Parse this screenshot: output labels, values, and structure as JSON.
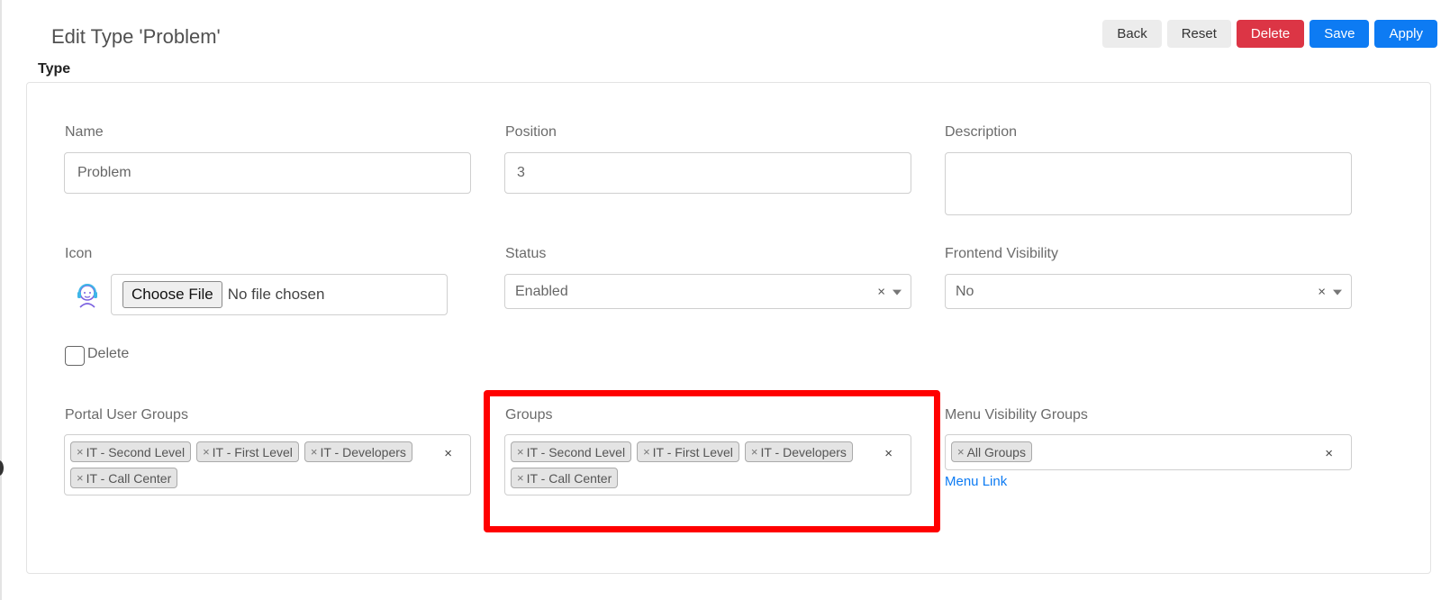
{
  "page": {
    "title": "Edit Type 'Problem'",
    "section_label": "Type"
  },
  "toolbar": {
    "back": "Back",
    "reset": "Reset",
    "delete": "Delete",
    "save": "Save",
    "apply": "Apply"
  },
  "colors": {
    "danger": "#dc3545",
    "primary": "#0d7bf3",
    "highlight": "#ff0000"
  },
  "form": {
    "name": {
      "label": "Name",
      "value": "Problem"
    },
    "position": {
      "label": "Position",
      "value": "3"
    },
    "description": {
      "label": "Description",
      "value": ""
    },
    "icon": {
      "label": "Icon",
      "preview_icon": "user-headset-icon",
      "file_button": "Choose File",
      "file_status": "No file chosen"
    },
    "status": {
      "label": "Status",
      "value": "Enabled"
    },
    "frontend_visibility": {
      "label": "Frontend Visibility",
      "value": "No"
    },
    "delete_checkbox": {
      "label": "Delete",
      "checked": false
    },
    "portal_user_groups": {
      "label": "Portal User Groups",
      "tags": [
        "IT - Second Level",
        "IT - First Level",
        "IT - Developers",
        "IT - Call Center"
      ]
    },
    "groups": {
      "label": "Groups",
      "tags": [
        "IT - Second Level",
        "IT - First Level",
        "IT - Developers",
        "IT - Call Center"
      ]
    },
    "menu_visibility_groups": {
      "label": "Menu Visibility Groups",
      "tags": [
        "All Groups"
      ],
      "link": "Menu Link"
    }
  },
  "symbols": {
    "remove": "×"
  }
}
